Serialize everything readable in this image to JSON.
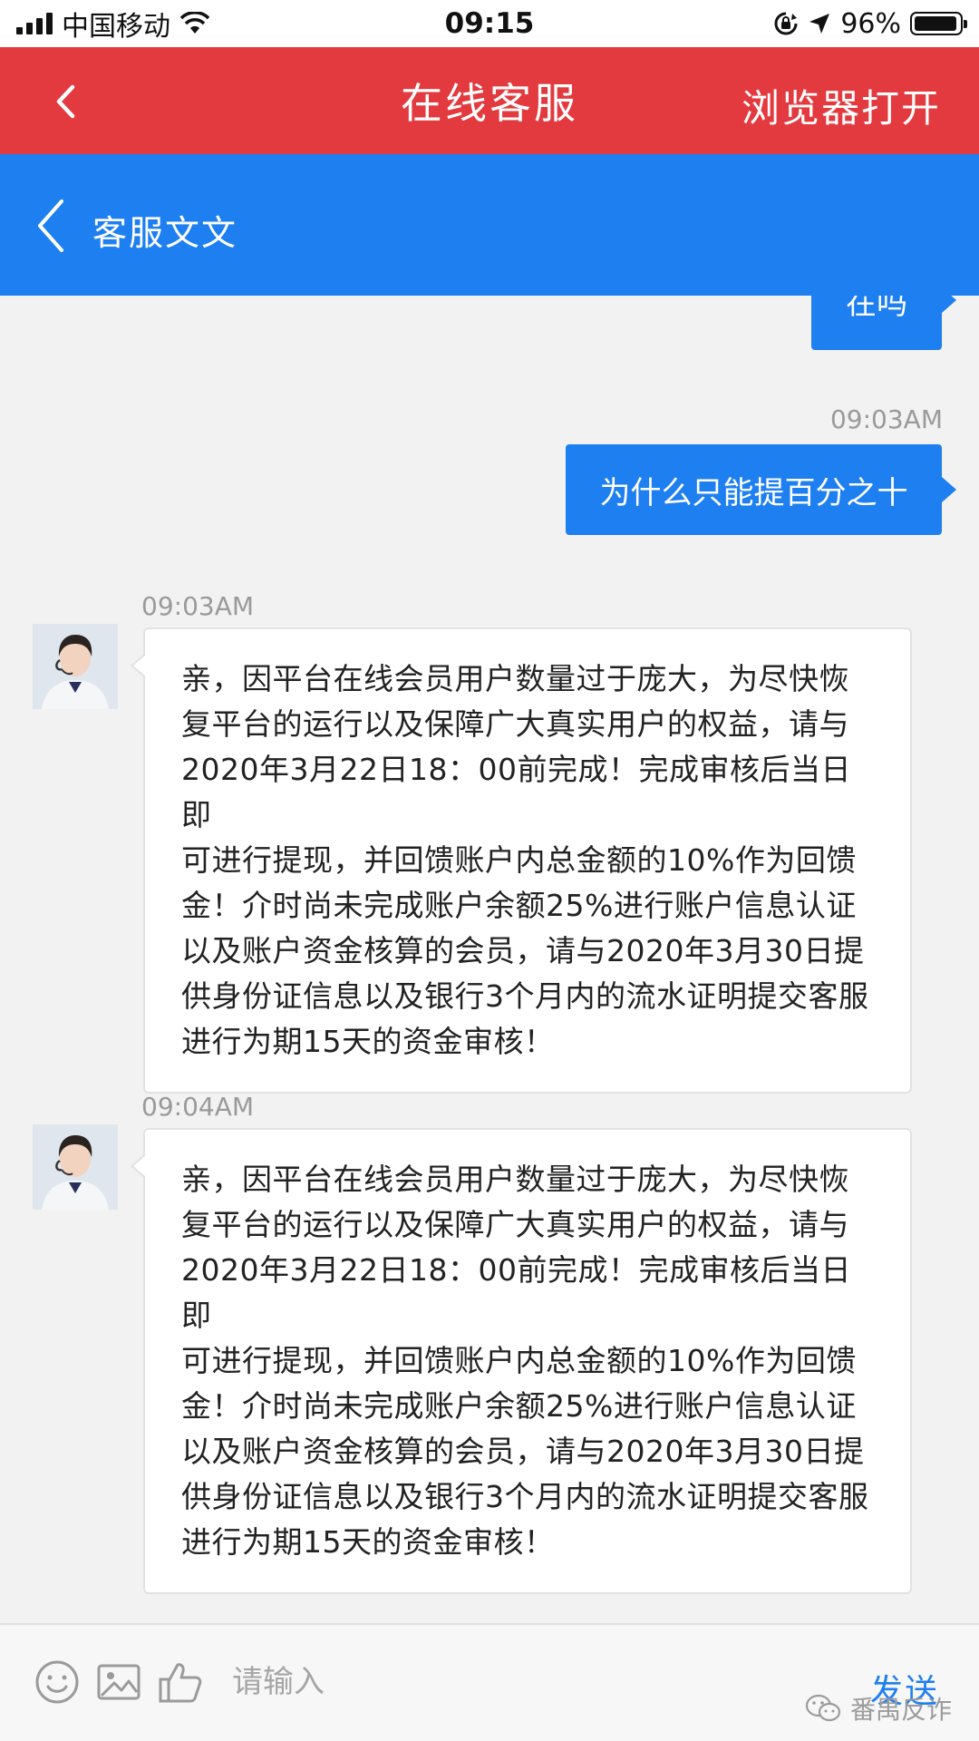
{
  "status_bar": {
    "carrier": "中国移动",
    "time": "09:15",
    "battery": "96%",
    "battery_level": 0.96
  },
  "title_bar": {
    "title": "在线客服",
    "open_in_browser": "浏览器打开"
  },
  "chat_header": {
    "agent_name": "客服文文"
  },
  "messages": [
    {
      "direction": "out",
      "text": "在吗"
    },
    {
      "direction": "out",
      "time": "09:03AM",
      "text": "为什么只能提百分之十"
    },
    {
      "direction": "in",
      "time": "09:03AM",
      "lines": [
        "亲，因平台在线会员用户数量过于庞大，为尽快恢",
        "复平台的运行以及保障广大真实用户的权益，请与",
        "2020年3月22日18：00前完成！完成审核后当日即",
        "可进行提现，并回馈账户内总金额的10%作为回馈",
        "金！介时尚未完成账户余额25%进行账户信息认证",
        "以及账户资金核算的会员，请与2020年3月30日提",
        "供身份证信息以及银行3个月内的流水证明提交客服",
        "进行为期15天的资金审核！"
      ]
    },
    {
      "direction": "in",
      "time": "09:04AM",
      "lines": [
        "亲，因平台在线会员用户数量过于庞大，为尽快恢",
        "复平台的运行以及保障广大真实用户的权益，请与",
        "2020年3月22日18：00前完成！完成审核后当日即",
        "可进行提现，并回馈账户内总金额的10%作为回馈",
        "金！介时尚未完成账户余额25%进行账户信息认证",
        "以及账户资金核算的会员，请与2020年3月30日提",
        "供身份证信息以及银行3个月内的流水证明提交客服",
        "进行为期15天的资金审核！"
      ]
    }
  ],
  "input_bar": {
    "placeholder": "请输入",
    "send_label": "发送",
    "watermark": "番禺反诈"
  },
  "colors": {
    "title_bar": "#e23a3f",
    "chat_header": "#1e7ff0",
    "outgoing_bubble": "#1e7ff0",
    "background": "#f2f2f2"
  }
}
